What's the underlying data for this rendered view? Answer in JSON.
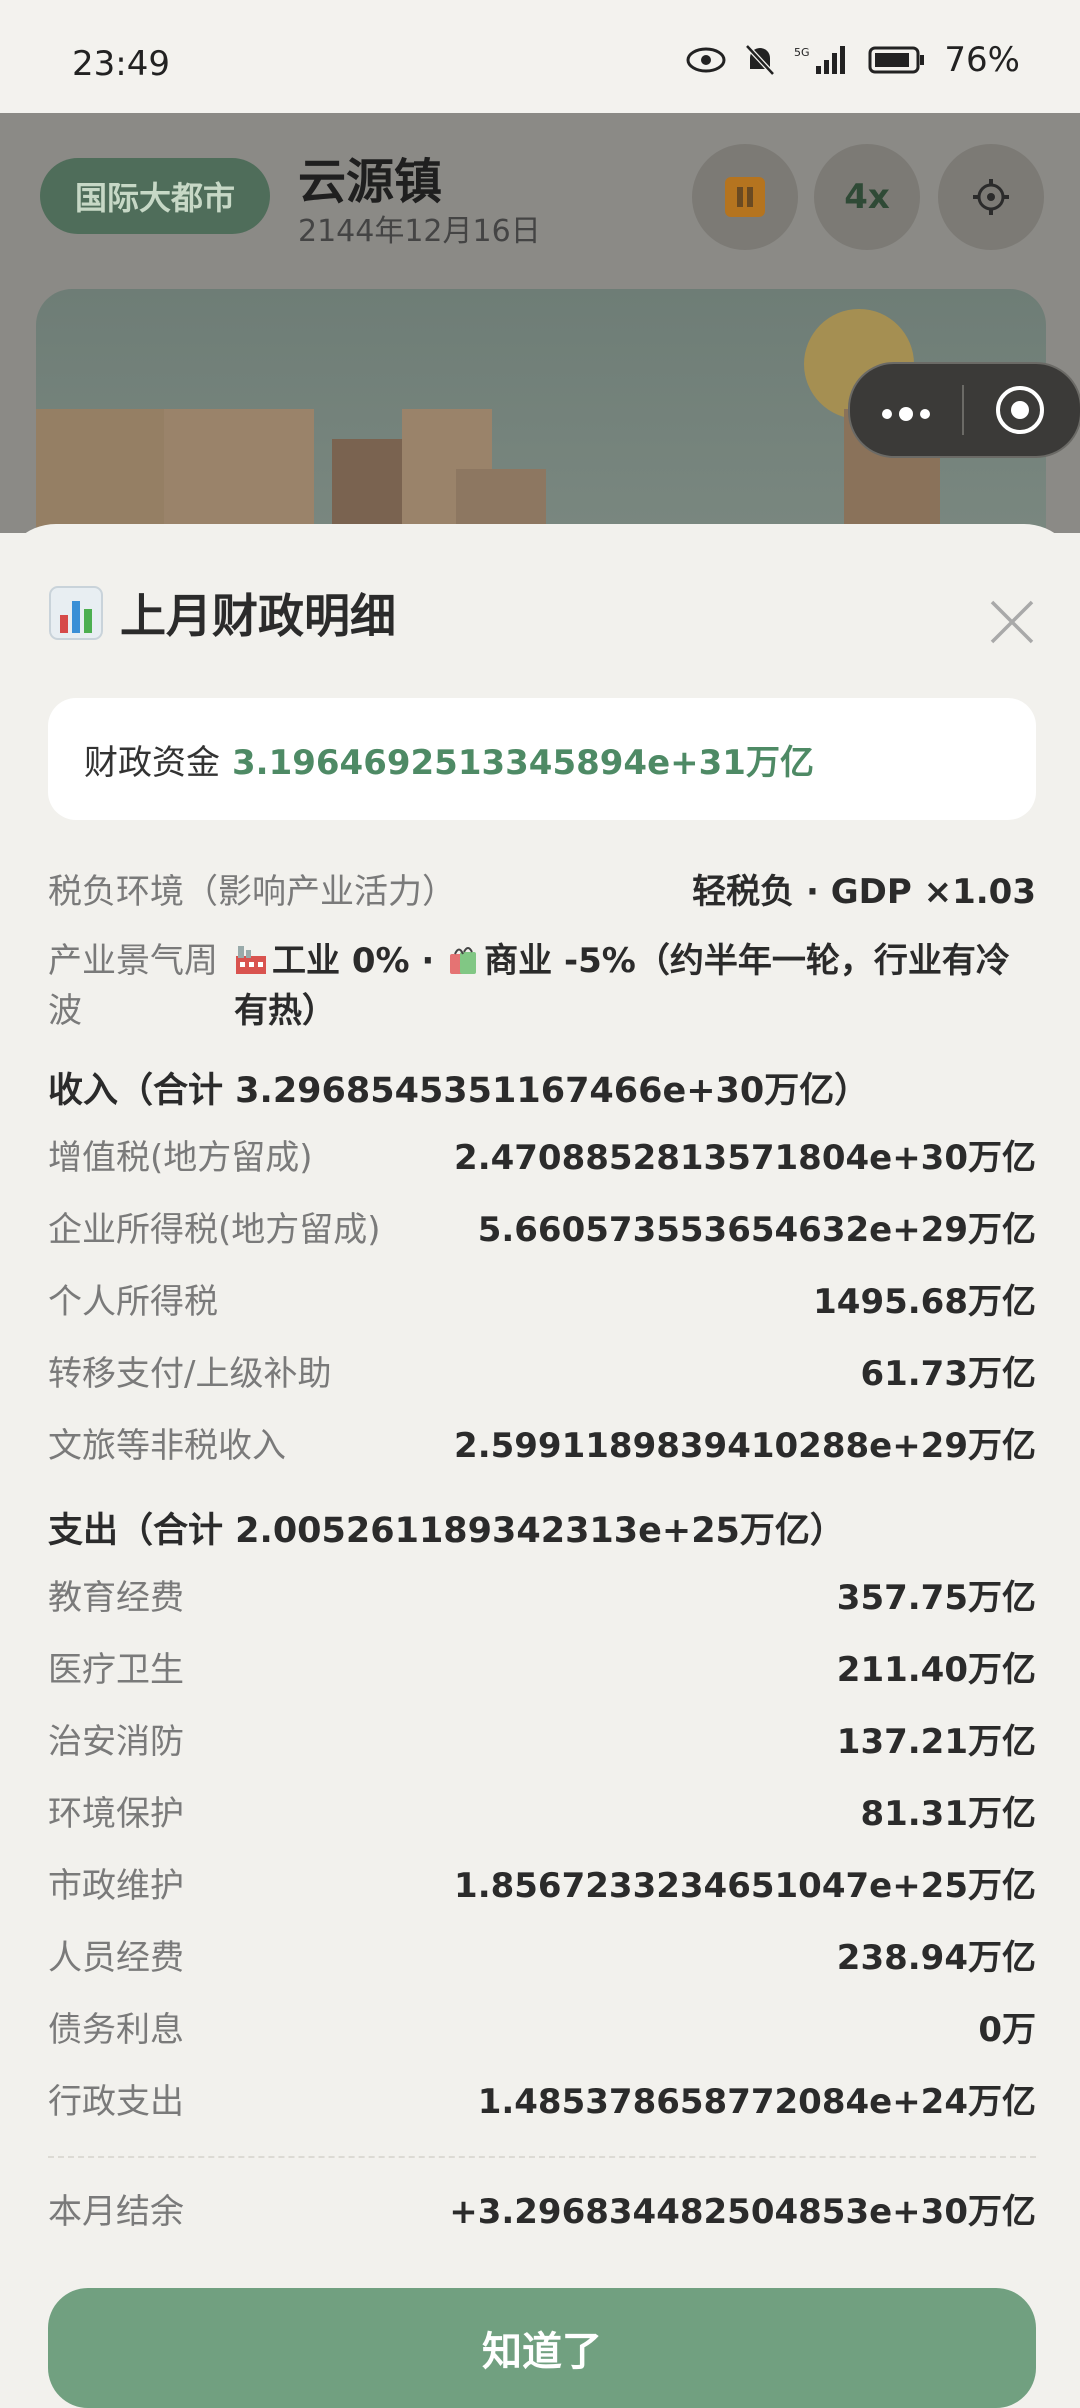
{
  "status": {
    "time": "23:49",
    "battery": "76%"
  },
  "header": {
    "level_badge": "国际大都市",
    "city_name": "云源镇",
    "date": "2144年12月16日",
    "speed_label": "4x"
  },
  "sheet": {
    "title": "上月财政明细",
    "fund_label": "财政资金",
    "fund_value": "3.1964692513345894e+31万亿",
    "tax_env_label": "税负环境（影响产业活力）",
    "tax_env_value": "轻税负 · GDP ×1.03",
    "cycle_label": "产业景气周波",
    "cycle_value_industry": "工业 0% · ",
    "cycle_value_commerce": "商业 -5%（约半年一轮，行业有冷有热）",
    "income_header": "收入（合计 3.2968545351167466e+30万亿）",
    "income": [
      {
        "label": "增值税(地方留成)",
        "value": "2.4708852813571804e+30万亿"
      },
      {
        "label": "企业所得税(地方留成)",
        "value": "5.660573553654632e+29万亿"
      },
      {
        "label": "个人所得税",
        "value": "1495.68万亿"
      },
      {
        "label": "转移支付/上级补助",
        "value": "61.73万亿"
      },
      {
        "label": "文旅等非税收入",
        "value": "2.5991189839410288e+29万亿"
      }
    ],
    "expense_header": "支出（合计 2.005261189342313e+25万亿）",
    "expense": [
      {
        "label": "教育经费",
        "value": "357.75万亿"
      },
      {
        "label": "医疗卫生",
        "value": "211.40万亿"
      },
      {
        "label": "治安消防",
        "value": "137.21万亿"
      },
      {
        "label": "环境保护",
        "value": "81.31万亿"
      },
      {
        "label": "市政维护",
        "value": "1.8567233234651047e+25万亿"
      },
      {
        "label": "人员经费",
        "value": "238.94万亿"
      },
      {
        "label": "债务利息",
        "value": "0万"
      },
      {
        "label": "行政支出",
        "value": "1.485378658772084e+24万亿"
      }
    ],
    "balance_label": "本月结余",
    "balance_value": "+3.296834482504853e+30万亿",
    "ok_label": "知道了"
  },
  "colors": {
    "accent": "#71a080",
    "fund_text": "#4e8a65",
    "badge_bg": "#4f6d5a"
  }
}
